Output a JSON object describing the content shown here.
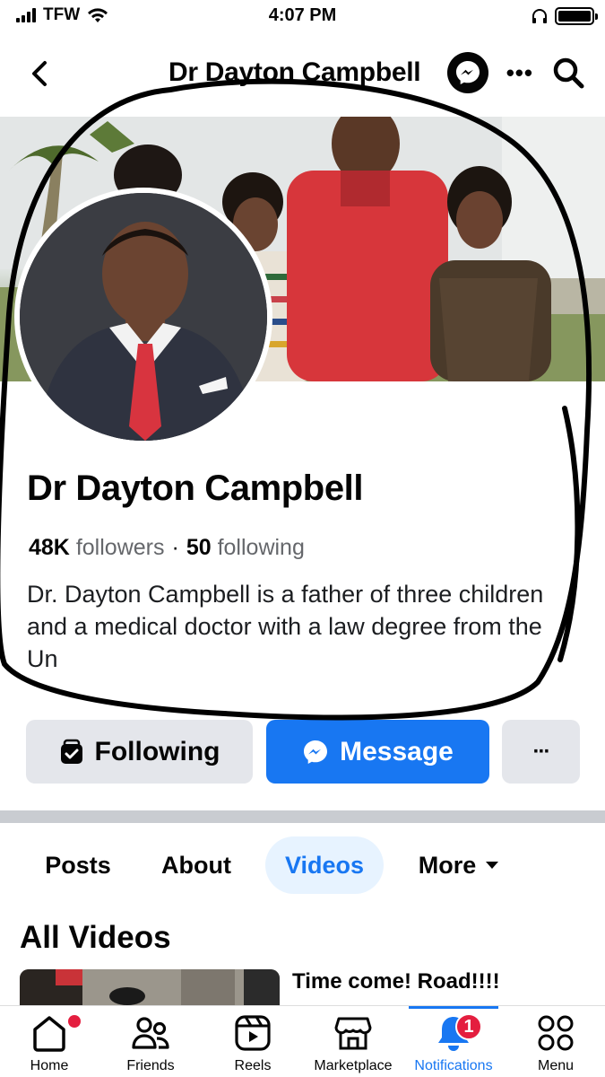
{
  "status_bar": {
    "carrier": "TFW",
    "time": "4:07 PM"
  },
  "header": {
    "title": "Dr Dayton Campbell"
  },
  "profile": {
    "name": "Dr Dayton Campbell",
    "followers_count": "48K",
    "followers_label": "followers",
    "separator": "·",
    "following_count": "50",
    "following_label": "following",
    "bio": "Dr. Dayton Campbell is a father of three children and a medical doctor with a law degree from the Un"
  },
  "actions": {
    "following_label": "Following",
    "message_label": "Message",
    "more_label": "···"
  },
  "tabs": [
    {
      "label": "Posts"
    },
    {
      "label": "About"
    },
    {
      "label": "Videos",
      "active": true
    },
    {
      "label": "More"
    }
  ],
  "videos_section": {
    "title": "All Videos",
    "items": [
      {
        "title": "Time come! Road!!!!"
      }
    ]
  },
  "bottom_nav": {
    "items": [
      {
        "label": "Home",
        "icon": "home-icon"
      },
      {
        "label": "Friends",
        "icon": "friends-icon"
      },
      {
        "label": "Reels",
        "icon": "reels-icon"
      },
      {
        "label": "Marketplace",
        "icon": "marketplace-icon"
      },
      {
        "label": "Notifications",
        "icon": "bell-icon",
        "active": true,
        "badge": "1"
      },
      {
        "label": "Menu",
        "icon": "menu-grid-icon"
      }
    ]
  },
  "colors": {
    "accent": "#1877f2",
    "badge": "#e41e3f",
    "button_gray": "#e4e6eb"
  }
}
